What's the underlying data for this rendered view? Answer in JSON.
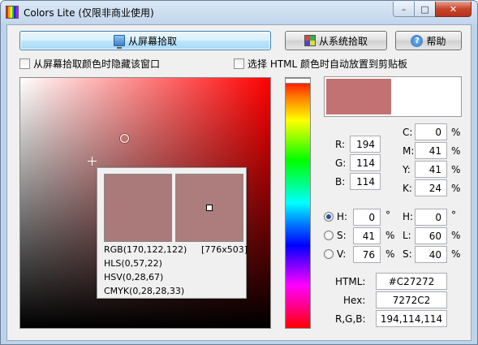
{
  "window": {
    "title": "Colors Lite (仅限非商业使用)",
    "controls": {
      "minimize": "–",
      "maximize": "□",
      "close": "✕"
    }
  },
  "toolbar": {
    "pick_screen_label": "从屏幕拾取",
    "pick_system_label": "从系统拾取",
    "help_label": "帮助"
  },
  "options": {
    "hide_window_label": "从屏幕拾取颜色时隐藏该窗口",
    "auto_clipboard_label": "选择 HTML 颜色时自动放置到剪贴板",
    "hide_window_checked": false,
    "auto_clipboard_checked": false
  },
  "magnifier": {
    "coords": "[776x503]",
    "rgb": "RGB(170,122,122)",
    "hls": "HLS(0,57,22)",
    "hsv": "HSV(0,28,67)",
    "cmyk": "CMYK(0,28,28,33)",
    "swatch_color": "#aa7a7a"
  },
  "preview": {
    "current_color": "#C27272",
    "previous_color": "#FFFFFF"
  },
  "rgb": {
    "r_label": "R:",
    "r_value": "194",
    "g_label": "G:",
    "g_value": "114",
    "b_label": "B:",
    "b_value": "114"
  },
  "cmyk": {
    "c_label": "C:",
    "c_value": "0",
    "m_label": "M:",
    "m_value": "41",
    "y_label": "Y:",
    "y_value": "41",
    "k_label": "K:",
    "k_value": "24",
    "unit": "%"
  },
  "hsv": {
    "h_label": "H:",
    "h_value": "0",
    "h_unit": "°",
    "s_label": "S:",
    "s_value": "41",
    "s_unit": "%",
    "v_label": "V:",
    "v_value": "76",
    "v_unit": "%",
    "selected": "H"
  },
  "hls": {
    "h_label": "H:",
    "h_value": "0",
    "h_unit": "°",
    "l_label": "L:",
    "l_value": "60",
    "l_unit": "%",
    "s_label": "S:",
    "s_value": "40",
    "s_unit": "%"
  },
  "codes": {
    "html_label": "HTML:",
    "html_value": "#C27272",
    "hex_label": "Hex:",
    "hex_value": "7272C2",
    "rgb_label": "R,G,B:",
    "rgb_value": "194,114,114"
  }
}
